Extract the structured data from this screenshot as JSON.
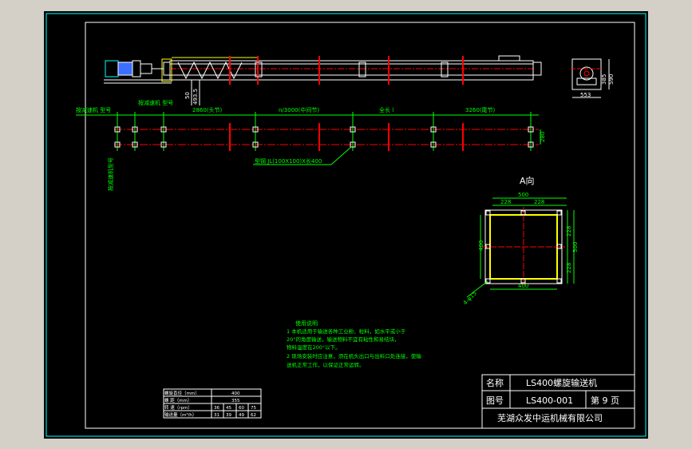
{
  "title_block": {
    "name_label": "名称",
    "name_value": "LS400螺旋输送机",
    "drawing_no_label": "图号",
    "drawing_no_value": "LS400-001",
    "page_label": "第 9 页",
    "company": "芜湖众发中运机械有限公司"
  },
  "labels": {
    "view_a": "A向",
    "drive_model_1": "按减速机 型号",
    "drive_model_2": "按减速机 型号",
    "drive_model_v": "按减速机型号",
    "seg_head": "2860(头节)",
    "seg_mid": "n/3000(中间节)",
    "seg_len": "全长 l",
    "seg_tail": "3260(尾节)",
    "dim_280": "280",
    "steel": "型钢 JL(100X100)X长400",
    "dim_50": "50",
    "dim_493": "493.5",
    "side_dim": "553",
    "side_h": "590",
    "side_h2": "385",
    "hole_note": "4-φ15"
  },
  "detail": {
    "w500": "500",
    "w228a": "228",
    "w228b": "228",
    "h400": "400",
    "h228a": "228",
    "h228b": "228",
    "b400": "400",
    "h500": "500"
  },
  "notes": {
    "title": "使用说明",
    "line1": "1  本机适用于输送各种工业粉、粒料，如水平或小于",
    "line2": "20°的角度输送，输送物料不宜有粘性和易结块，",
    "line3": "物料温度在200°以下。",
    "line4": "2  现场安装时应注意，须在机头出口与出料口处连接，使输",
    "line5": "送机正常工作，以保证正常运转。"
  },
  "spec_table": {
    "headers": [
      "螺旋直径（mm）",
      "螺    距（mm）",
      "转    速（rpm）",
      "输送量（m³/h）"
    ],
    "col1": [
      "400",
      "355"
    ],
    "speeds": [
      "36",
      "45",
      "60",
      "75"
    ],
    "capacities": [
      "31",
      "39",
      "49",
      "62"
    ]
  },
  "colors": {
    "line_white": "#ffffff",
    "line_yellow": "#ffff00",
    "line_red": "#ff0000",
    "line_green": "#00ff00",
    "line_cyan": "#00ffff",
    "line_blue": "#3b6fff"
  }
}
